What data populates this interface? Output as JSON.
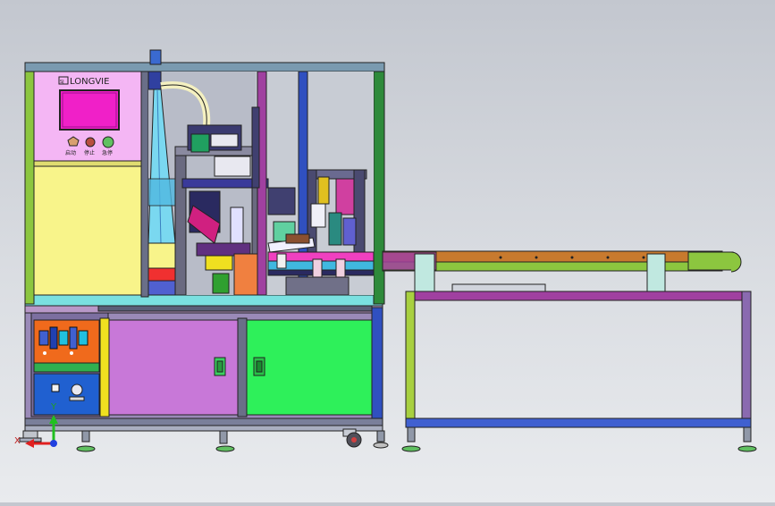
{
  "brand": {
    "logo_text": "LONGVIE",
    "logo_prefix": "SJ"
  },
  "control_panel": {
    "buttons": [
      {
        "label": "启动",
        "color": "#d8a070"
      },
      {
        "label": "停止",
        "color": "#b85040"
      },
      {
        "label": "急停",
        "color": "#60c060"
      }
    ]
  },
  "axes_triad": {
    "x_label": "X",
    "y_label": "Y"
  },
  "colors": {
    "frame_green": "#8cc63f",
    "cabinet_pink": "#f4b6f4",
    "cabinet_yellow": "#f8f48a",
    "door_purple": "#c878d8",
    "door_green": "#2ef05a",
    "conveyor_brown": "#c87a2e",
    "screen_magenta": "#f020c8"
  }
}
